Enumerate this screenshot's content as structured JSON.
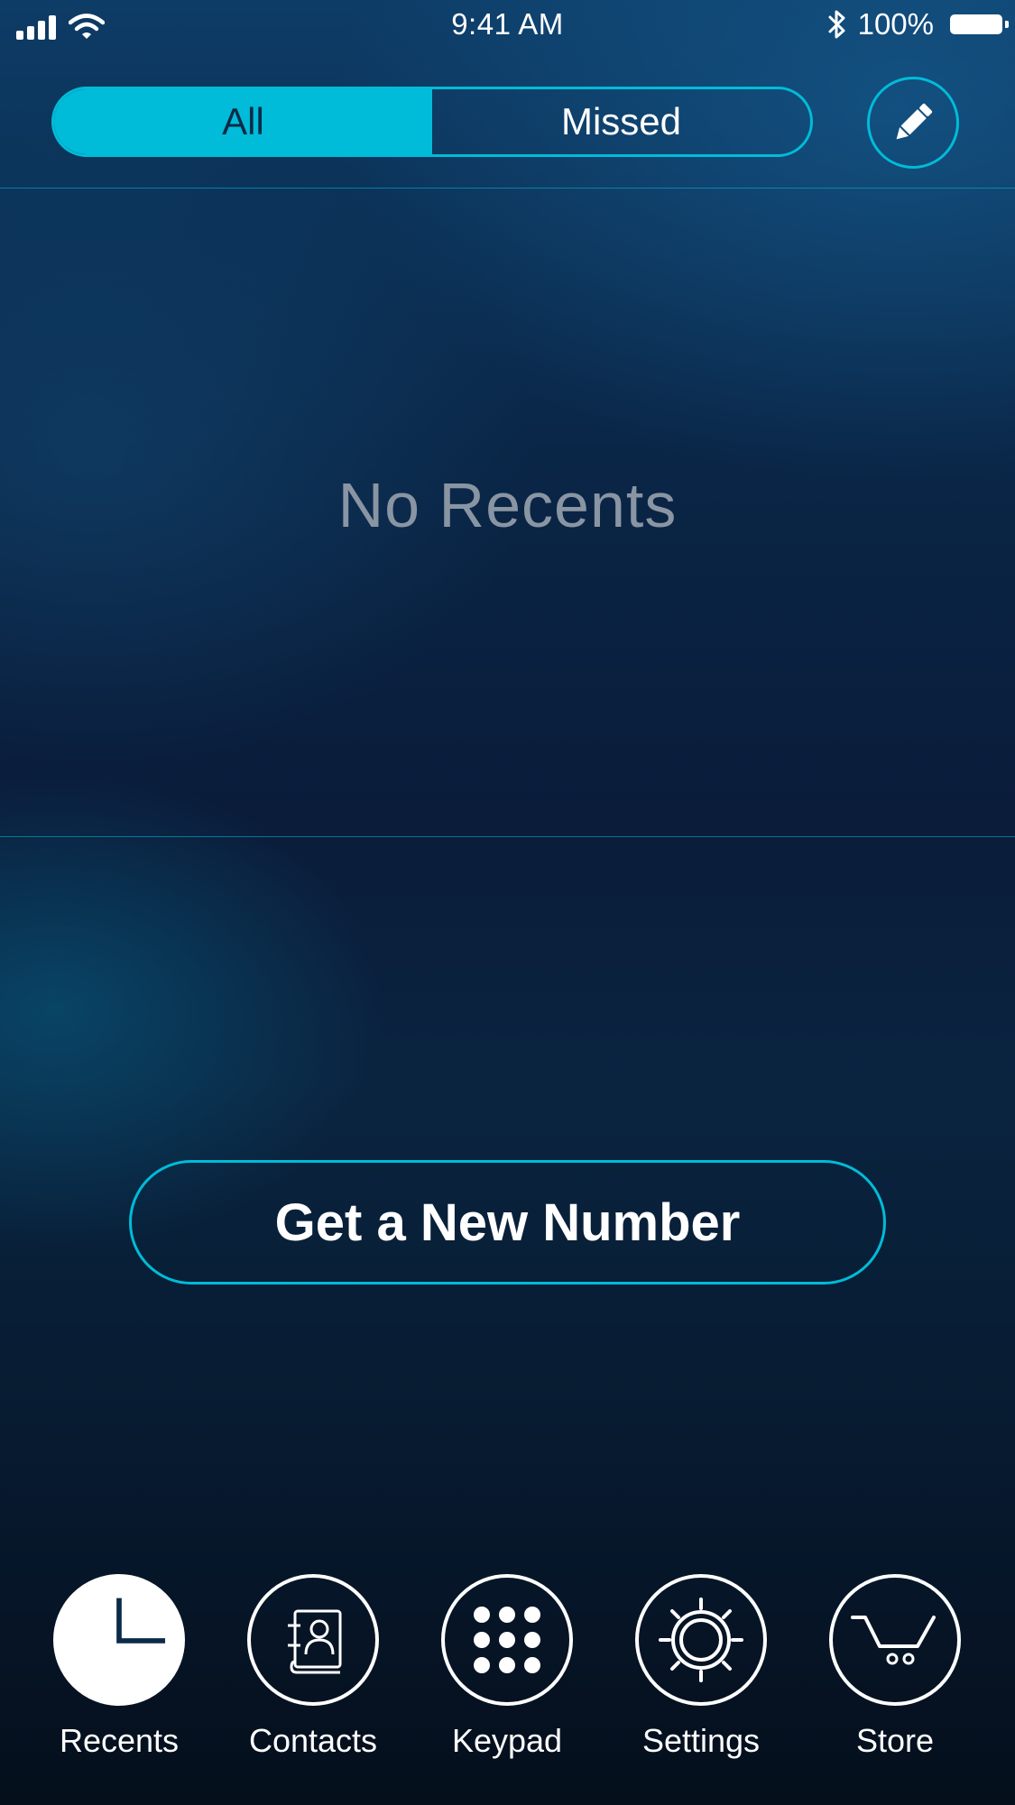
{
  "status_bar": {
    "time": "9:41 AM",
    "battery_percent": "100%",
    "icons": [
      "signal-icon",
      "wifi-icon",
      "bluetooth-icon",
      "battery-icon"
    ]
  },
  "segments": {
    "all_label": "All",
    "missed_label": "Missed",
    "selected": "All"
  },
  "edit_icon": "pencil-icon",
  "empty_state": {
    "message": "No Recents"
  },
  "cta": {
    "label": "Get a New Number"
  },
  "tabs": [
    {
      "label": "Recents",
      "icon": "clock-icon",
      "active": true
    },
    {
      "label": "Contacts",
      "icon": "contacts-book-icon",
      "active": false
    },
    {
      "label": "Keypad",
      "icon": "keypad-icon",
      "active": false
    },
    {
      "label": "Settings",
      "icon": "gear-icon",
      "active": false
    },
    {
      "label": "Store",
      "icon": "cart-icon",
      "active": false
    }
  ],
  "colors": {
    "accent": "#00bcd8",
    "background_top": "#0d3c66",
    "background_bottom": "#050f1c",
    "muted_text": "#8a95a3"
  }
}
